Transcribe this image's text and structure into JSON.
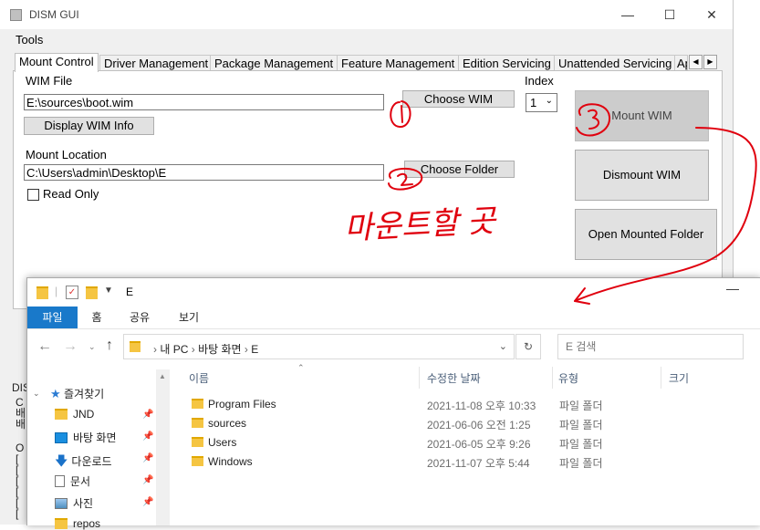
{
  "dism": {
    "title": "DISM GUI",
    "menu": [
      "Tools"
    ],
    "tabs": [
      "Mount Control",
      "Driver Management",
      "Package Management",
      "Feature Management",
      "Edition Servicing",
      "Unattended Servicing",
      "Ap"
    ],
    "wim_file_label": "WIM File",
    "wim_file_value": "E:\\sources\\boot.wim",
    "choose_wim_label": "Choose WIM",
    "display_wim_info_label": "Display WIM Info",
    "index_label": "Index",
    "index_value": "1",
    "mount_location_label": "Mount Location",
    "mount_location_value": "C:\\Users\\admin\\Desktop\\E",
    "choose_folder_label": "Choose Folder",
    "read_only_label": "Read Only",
    "mount_wim_label": "Mount WIM",
    "dismount_wim_label": "Dismount WIM",
    "open_mounted_folder_label": "Open Mounted Folder",
    "partial_side_text": [
      "DIS",
      "C",
      "배",
      "배",
      "O",
      "[",
      "[",
      "[",
      "[",
      "[",
      "["
    ]
  },
  "explorer": {
    "title": "E",
    "ribbon_tabs": [
      "파일",
      "홈",
      "공유",
      "보기"
    ],
    "breadcrumb": [
      "내 PC",
      "바탕 화면",
      "E"
    ],
    "search_placeholder": "E 검색",
    "columns": [
      "이름",
      "수정한 날짜",
      "유형",
      "크기"
    ],
    "tree": [
      {
        "label": "즐겨찾기",
        "icon": "star-icon"
      },
      {
        "label": "JND",
        "icon": "folder-icon"
      },
      {
        "label": "바탕 화면",
        "icon": "desktop-icon"
      },
      {
        "label": "다운로드",
        "icon": "download-icon"
      },
      {
        "label": "문서",
        "icon": "document-icon"
      },
      {
        "label": "사진",
        "icon": "picture-icon"
      },
      {
        "label": "repos",
        "icon": "folder-icon"
      }
    ],
    "rows": [
      {
        "name": "Program Files",
        "date": "2021-11-08 오후 10:33",
        "type": "파일 폴더"
      },
      {
        "name": "sources",
        "date": "2021-06-06 오전 1:25",
        "type": "파일 폴더"
      },
      {
        "name": "Users",
        "date": "2021-06-05 오후 9:26",
        "type": "파일 폴더"
      },
      {
        "name": "Windows",
        "date": "2021-11-07 오후 5:44",
        "type": "파일 폴더"
      }
    ]
  },
  "annotations": {
    "handwritten_text": "마운트할 곳",
    "step_numbers": [
      "1",
      "2",
      "3"
    ],
    "ink_color": "#e0000e"
  },
  "colors": {
    "accent_blue": "#1979ca",
    "window_bg": "#f0f0f0",
    "button_bg": "#e1e1e1"
  }
}
